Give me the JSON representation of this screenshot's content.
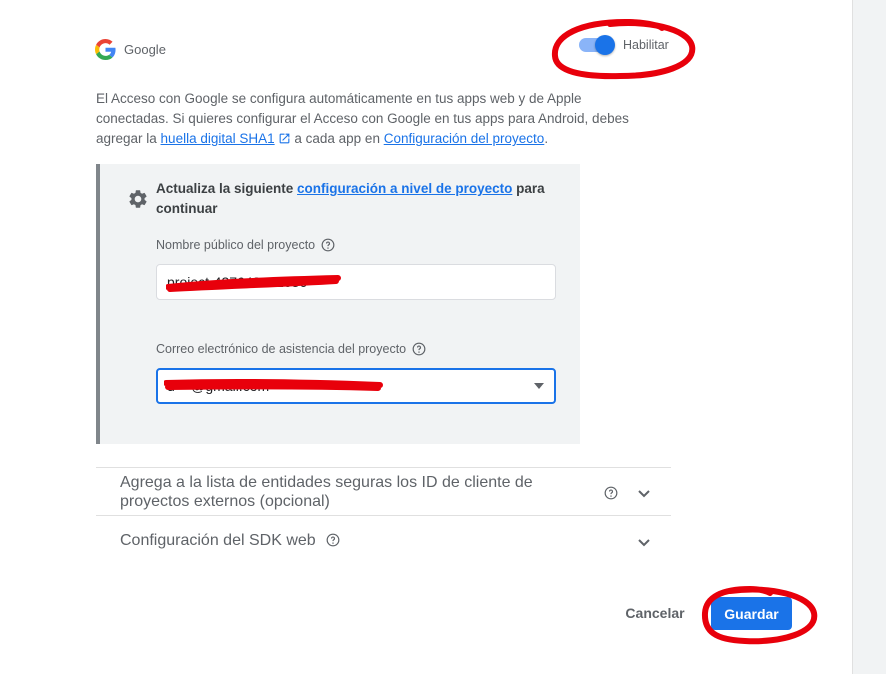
{
  "provider": {
    "name": "Google",
    "logo_icon": "google-g-icon"
  },
  "toggle": {
    "label": "Habilitar",
    "enabled": true,
    "accent": "#1a73e8"
  },
  "intro": {
    "text_before": "El Acceso con Google se configura automáticamente en tus apps web y de Apple conectadas. Si quieres configurar el Acceso con Google en tus apps para Android, debes agregar la ",
    "sha1_link": "huella digital SHA1",
    "text_middle": " a cada app en ",
    "project_config_link": "Configuración del proyecto",
    "text_after": "."
  },
  "project_config": {
    "heading_before": "Actualiza la siguiente ",
    "heading_link": "configuración a nivel de proyecto",
    "heading_after": " para continuar",
    "public_name_label": "Nombre público del proyecto",
    "public_name_value": "project-437643622636",
    "support_email_label": "Correo electrónico de asistencia del proyecto",
    "support_email_value": "d***@gmail.com"
  },
  "expanders": [
    {
      "title": "Agrega a la lista de entidades seguras los ID de cliente de proyectos externos (opcional)"
    },
    {
      "title": "Configuración del SDK web"
    }
  ],
  "actions": {
    "cancel": "Cancelar",
    "save": "Guardar"
  },
  "colors": {
    "primary": "#1a73e8",
    "panel": "#f1f3f4",
    "annotation_red": "#e8000b"
  }
}
